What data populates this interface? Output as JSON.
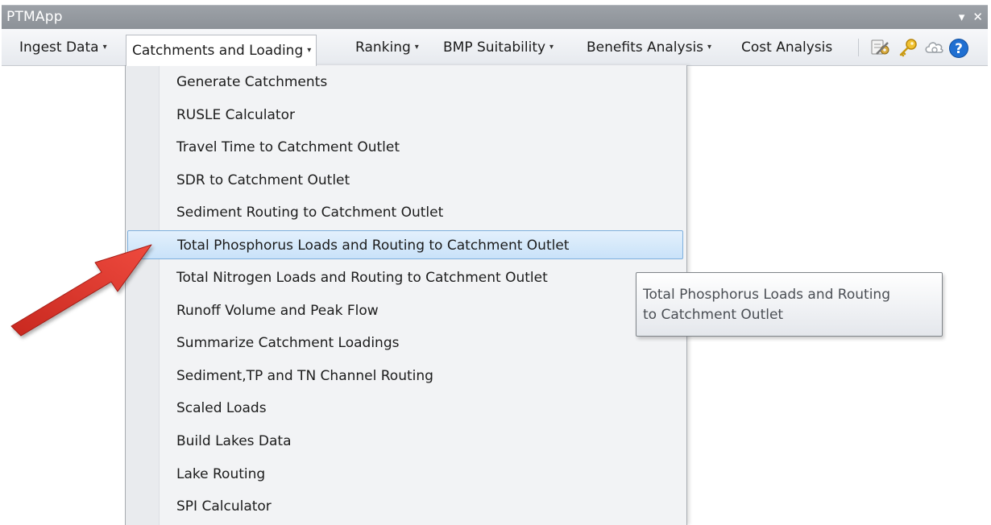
{
  "window": {
    "title": "PTMApp",
    "controls": {
      "dropdown": "▾",
      "close": "✕"
    }
  },
  "toolbar": {
    "menus": [
      {
        "label": "Ingest Data",
        "has_caret": true
      },
      {
        "label": "Catchments and Loading",
        "has_caret": true,
        "open": true
      },
      {
        "label": "Ranking",
        "has_caret": true
      },
      {
        "label": "BMP Suitability",
        "has_caret": true
      },
      {
        "label": "Benefits Analysis",
        "has_caret": true
      },
      {
        "label": "Cost Analysis",
        "has_caret": false
      }
    ],
    "caret_glyph": "▾",
    "icons": [
      "settings-tools-icon",
      "key-icon",
      "cloud-icon",
      "help-icon"
    ]
  },
  "menu": {
    "items": [
      {
        "label": "Generate Catchments"
      },
      {
        "label": "RUSLE Calculator"
      },
      {
        "label": "Travel Time to Catchment Outlet"
      },
      {
        "label": "SDR to Catchment Outlet"
      },
      {
        "label": "Sediment Routing to Catchment Outlet"
      },
      {
        "label": "Total Phosphorus Loads and Routing to Catchment Outlet",
        "highlighted": true
      },
      {
        "label": "Total Nitrogen Loads and Routing to Catchment Outlet"
      },
      {
        "label": "Runoff Volume and Peak Flow"
      },
      {
        "label": "Summarize Catchment Loadings"
      },
      {
        "label": "Sediment,TP and TN Channel Routing"
      },
      {
        "label": "Scaled Loads"
      },
      {
        "label": "Build Lakes Data"
      },
      {
        "label": "Lake Routing"
      },
      {
        "label": "SPI Calculator"
      }
    ]
  },
  "tooltip": {
    "line1": "Total Phosphorus Loads and Routing",
    "line2": "to Catchment Outlet"
  },
  "colors": {
    "title_bar": "#8c9197",
    "highlight": "#c9e2f9",
    "highlight_border": "#7fb0de",
    "arrow": "#e03c31",
    "help": "#1f6fd1"
  }
}
